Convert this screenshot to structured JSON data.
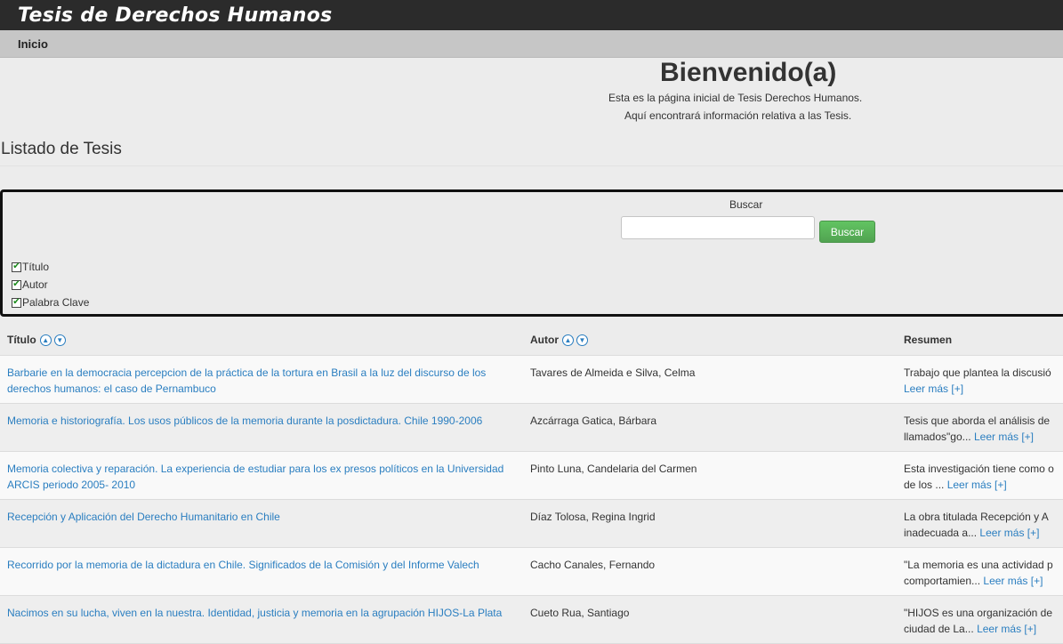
{
  "header": {
    "brand": "Tesis de Derechos Humanos"
  },
  "nav": {
    "home": "Inicio"
  },
  "welcome": {
    "title": "Bienvenido(a)",
    "line1": "Esta es la página inicial de Tesis Derechos Humanos.",
    "line2": "Aquí encontrará información relativa a las Tesis."
  },
  "list_title": "Listado de Tesis",
  "search": {
    "label": "Buscar",
    "value": "",
    "placeholder": "",
    "button": "Buscar",
    "filters": [
      {
        "label": "Título",
        "checked": true
      },
      {
        "label": "Autor",
        "checked": true
      },
      {
        "label": "Palabra Clave",
        "checked": true
      }
    ]
  },
  "table": {
    "headers": {
      "title": "Título",
      "author": "Autor",
      "summary": "Resumen"
    },
    "rows": [
      {
        "title": "Barbarie en la democracia percepcion de la práctica de la tortura en Brasil a la luz del discurso de los derechos humanos: el caso de Pernambuco",
        "author": "Tavares de Almeida e Silva, Celma",
        "summary1": "Trabajo que plantea la discusió",
        "summary2": "",
        "more": "Leer más [+]"
      },
      {
        "title": "Memoria e historiografía. Los usos públicos de la memoria durante la posdictadura. Chile 1990-2006",
        "author": "Azcárraga Gatica, Bárbara",
        "summary1": "Tesis que aborda el análisis de",
        "summary2": "llamados\"go...",
        "more": "Leer más [+]"
      },
      {
        "title": "Memoria colectiva y reparación. La experiencia de estudiar para los ex presos políticos en la Universidad ARCIS periodo 2005- 2010",
        "author": "Pinto Luna, Candelaria del Carmen",
        "summary1": "Esta investigación tiene como o",
        "summary2": "de los ...",
        "more": "Leer más [+]"
      },
      {
        "title": "Recepción y Aplicación del Derecho Humanitario en Chile",
        "author": "Díaz Tolosa, Regina Ingrid",
        "summary1": "La obra titulada Recepción y A",
        "summary2": "inadecuada a...",
        "more": "Leer más [+]"
      },
      {
        "title": "Recorrido por la memoria de la dictadura en Chile. Significados de la Comisión y del Informe Valech",
        "author": "Cacho Canales, Fernando",
        "summary1": "\"La memoria es una actividad p",
        "summary2": "comportamien...",
        "more": "Leer más [+]"
      },
      {
        "title": "Nacimos en su lucha, viven en la nuestra. Identidad, justicia y memoria en la agrupación HIJOS-La Plata",
        "author": "Cueto Rua, Santiago",
        "summary1": "\"HIJOS es una organización de",
        "summary2": "ciudad de La...",
        "more": "Leer más [+]"
      }
    ]
  }
}
